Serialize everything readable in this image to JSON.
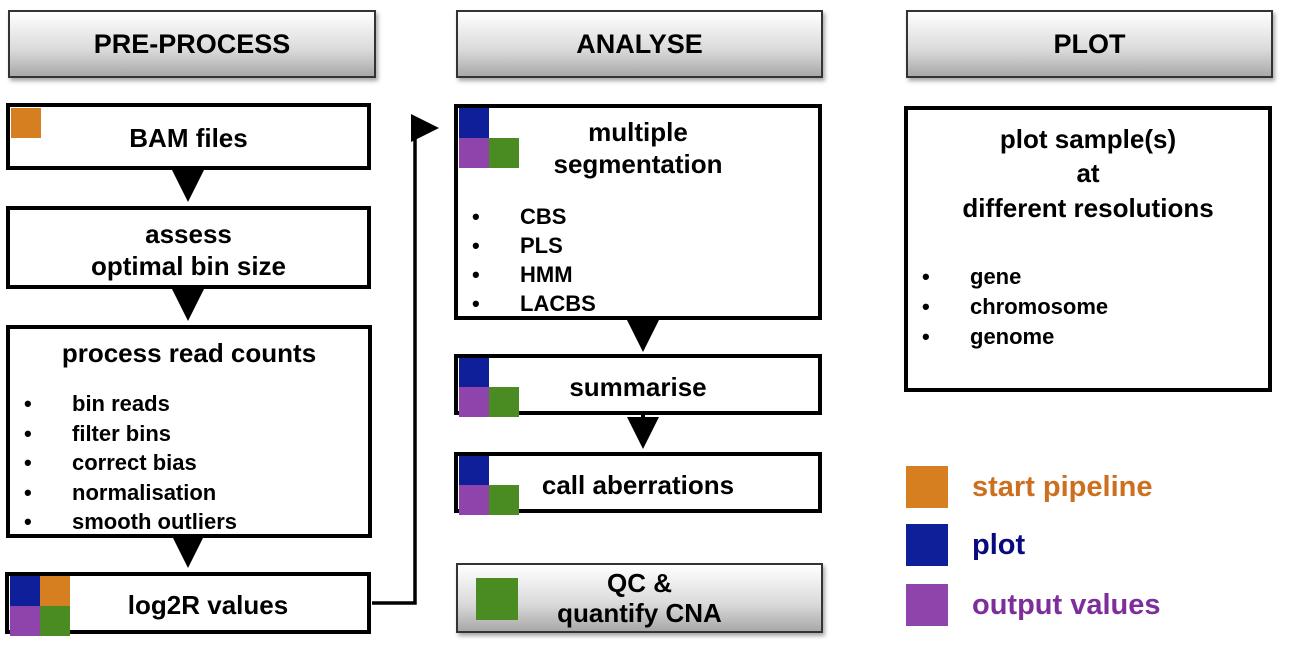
{
  "headers": {
    "preprocess": "PRE-PROCESS",
    "analyse": "ANALYSE",
    "plot": "PLOT"
  },
  "preprocess": {
    "bam": "BAM files",
    "assess": [
      "assess",
      "optimal bin size"
    ],
    "process": {
      "title": "process read counts",
      "items": [
        "bin reads",
        "filter bins",
        "correct bias",
        "normalisation",
        "smooth outliers"
      ]
    },
    "log2r": "log2R values"
  },
  "analyse": {
    "segmentation": {
      "title": [
        "multiple",
        "segmentation"
      ],
      "items": [
        "CBS",
        "PLS",
        "HMM",
        "LACBS"
      ]
    },
    "summarise": "summarise",
    "call": "call aberrations",
    "qc": [
      "QC &",
      "quantify CNA"
    ]
  },
  "plot": {
    "title": [
      "plot sample(s)",
      "at",
      "different resolutions"
    ],
    "items": [
      "gene",
      "chromosome",
      "genome"
    ]
  },
  "bullet": "•",
  "legend": [
    {
      "label": "start pipeline",
      "color": "#d57f21",
      "text_color": "#cc6f1e"
    },
    {
      "label": "plot",
      "color": "#0f1f9a",
      "text_color": "#0a0a80"
    },
    {
      "label": "output values",
      "color": "#8e44ab",
      "text_color": "#7d2e9b"
    }
  ]
}
